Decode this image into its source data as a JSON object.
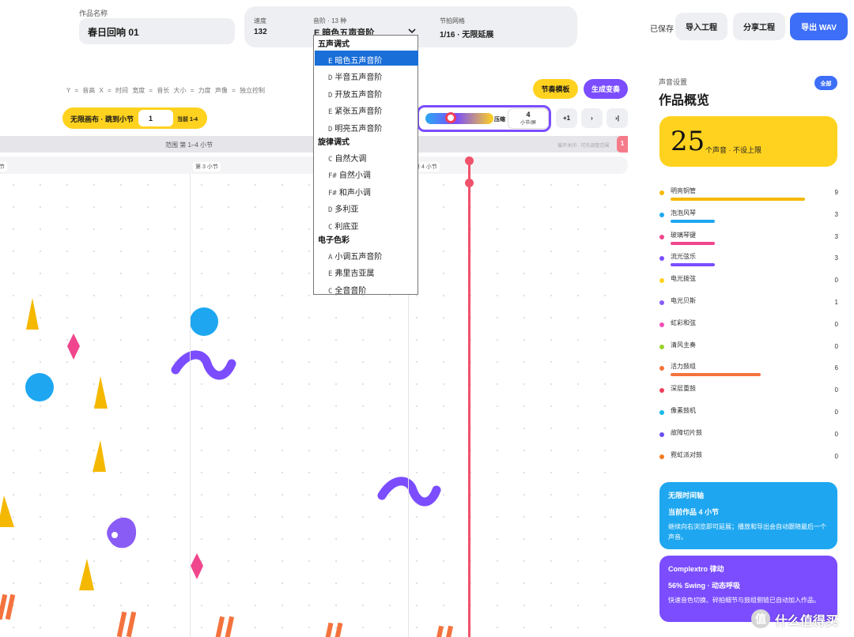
{
  "project": {
    "name_label": "作品名称",
    "name_value": "春日回响 01"
  },
  "params": {
    "tempo_label": "速度",
    "tempo_value": "132",
    "scale_label": "音阶 · 13 种",
    "scale_value": "E 暗色五声音阶",
    "grid_label": "节拍网格",
    "grid_value": "1/16 · 无限延展"
  },
  "toolbar": {
    "saved": "已保存",
    "import": "导入工程",
    "share": "分享工程",
    "export": "导出 WAV"
  },
  "canvas": {
    "legend": "Y = 音高 X = 时间 宽度 = 音长 大小 = 力度 声像 = 独立控制",
    "rhythm_template": "节奏模板",
    "generate_variation": "生成变奏",
    "jump_label": "无限画布 · 跳到小节",
    "jump_value": "1",
    "jump_current": "当前 1-4",
    "zoom_label": "压缩",
    "zoom_value": "4",
    "zoom_unit": "小节/屏",
    "nav_plus": "+1",
    "nav_next": "›",
    "nav_end": "›|",
    "range_text": "范围 第 1–4 小节",
    "range_right": "循环关闭 · 可先调整范围",
    "range_tag": "1",
    "bars": [
      "节",
      "第 3 小节",
      "第 4 小节"
    ]
  },
  "scale_dropdown": {
    "groups": [
      {
        "name": "五声调式",
        "items": [
          {
            "root": "E",
            "name": "暗色五声音阶",
            "selected": true
          },
          {
            "root": "D",
            "name": "半音五声音阶"
          },
          {
            "root": "D",
            "name": "开放五声音阶"
          },
          {
            "root": "E",
            "name": "紧张五声音阶"
          },
          {
            "root": "D",
            "name": "明亮五声音阶"
          }
        ]
      },
      {
        "name": "旋律调式",
        "items": [
          {
            "root": "C",
            "name": "自然大调"
          },
          {
            "root": "F#",
            "name": "自然小调"
          },
          {
            "root": "F#",
            "name": "和声小调"
          },
          {
            "root": "D",
            "name": "多利亚"
          },
          {
            "root": "C",
            "name": "利底亚"
          }
        ]
      },
      {
        "name": "电子色彩",
        "items": [
          {
            "root": "A",
            "name": "小调五声音阶"
          },
          {
            "root": "E",
            "name": "弗里吉亚属"
          },
          {
            "root": "C",
            "name": "全音音阶"
          }
        ]
      }
    ]
  },
  "sidebar": {
    "label": "声音设置",
    "title": "作品概览",
    "all_button": "全部",
    "count": "25",
    "count_text": "个声音 · 不设上限",
    "voices": [
      {
        "name": "明亮铜管",
        "count": "9",
        "color": "#f5b800",
        "fill": 0.85
      },
      {
        "name": "泡泡风琴",
        "count": "3",
        "color": "#1ea7f0",
        "fill": 0.28
      },
      {
        "name": "玻璃琴键",
        "count": "3",
        "color": "#f0468d",
        "fill": 0.28
      },
      {
        "name": "流光弦乐",
        "count": "3",
        "color": "#7b4dff",
        "fill": 0.28
      },
      {
        "name": "电光拨弦",
        "count": "0",
        "color": "#ffd21f",
        "fill": 0
      },
      {
        "name": "电光贝斯",
        "count": "1",
        "color": "#8a5cf6",
        "fill": 0
      },
      {
        "name": "虹彩和弦",
        "count": "0",
        "color": "#f04fb6",
        "fill": 0
      },
      {
        "name": "清风主奏",
        "count": "0",
        "color": "#9ad22e",
        "fill": 0
      },
      {
        "name": "活力鼓组",
        "count": "6",
        "color": "#f4733d",
        "fill": 0.57
      },
      {
        "name": "深层重鼓",
        "count": "0",
        "color": "#ef3f5b",
        "fill": 0
      },
      {
        "name": "像素鼓机",
        "count": "0",
        "color": "#17b8e8",
        "fill": 0
      },
      {
        "name": "故障切片鼓",
        "count": "0",
        "color": "#6a4df2",
        "fill": 0
      },
      {
        "name": "霓虹派对鼓",
        "count": "0",
        "color": "#f47a1f",
        "fill": 0
      }
    ],
    "timeline_card": {
      "title": "无限时间轴",
      "sub": "当前作品 4 小节",
      "desc": "继续向右浏览即可延展；播放和导出会自动跟随最后一个声音。",
      "color": "#1ea7f0"
    },
    "groove_card": {
      "title": "Complextro 律动",
      "sub": "56% Swing · 动态呼吸",
      "desc": "快速音色切换、碎拍细节与鼓组侧链已自动加入作品。",
      "color": "#7b4dff"
    }
  },
  "watermark": {
    "icon": "值",
    "text": "什么值得买"
  },
  "colors": {
    "accent_blue": "#3d6ef7",
    "accent_yellow": "#ffd21f",
    "accent_purple": "#7b4dff",
    "playhead": "#f0526c"
  }
}
